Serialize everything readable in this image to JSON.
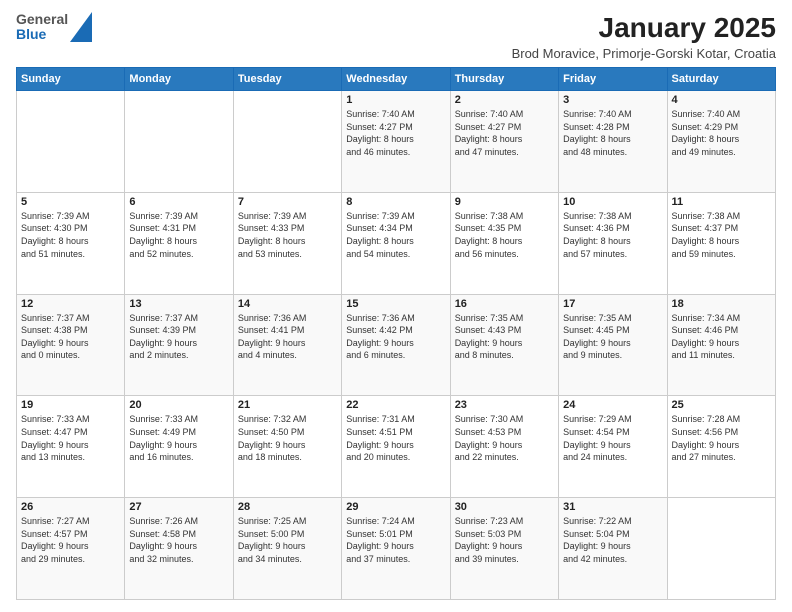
{
  "logo": {
    "general": "General",
    "blue": "Blue"
  },
  "title": "January 2025",
  "subtitle": "Brod Moravice, Primorje-Gorski Kotar, Croatia",
  "weekdays": [
    "Sunday",
    "Monday",
    "Tuesday",
    "Wednesday",
    "Thursday",
    "Friday",
    "Saturday"
  ],
  "weeks": [
    [
      {
        "day": "",
        "info": ""
      },
      {
        "day": "",
        "info": ""
      },
      {
        "day": "",
        "info": ""
      },
      {
        "day": "1",
        "info": "Sunrise: 7:40 AM\nSunset: 4:27 PM\nDaylight: 8 hours\nand 46 minutes."
      },
      {
        "day": "2",
        "info": "Sunrise: 7:40 AM\nSunset: 4:27 PM\nDaylight: 8 hours\nand 47 minutes."
      },
      {
        "day": "3",
        "info": "Sunrise: 7:40 AM\nSunset: 4:28 PM\nDaylight: 8 hours\nand 48 minutes."
      },
      {
        "day": "4",
        "info": "Sunrise: 7:40 AM\nSunset: 4:29 PM\nDaylight: 8 hours\nand 49 minutes."
      }
    ],
    [
      {
        "day": "5",
        "info": "Sunrise: 7:39 AM\nSunset: 4:30 PM\nDaylight: 8 hours\nand 51 minutes."
      },
      {
        "day": "6",
        "info": "Sunrise: 7:39 AM\nSunset: 4:31 PM\nDaylight: 8 hours\nand 52 minutes."
      },
      {
        "day": "7",
        "info": "Sunrise: 7:39 AM\nSunset: 4:33 PM\nDaylight: 8 hours\nand 53 minutes."
      },
      {
        "day": "8",
        "info": "Sunrise: 7:39 AM\nSunset: 4:34 PM\nDaylight: 8 hours\nand 54 minutes."
      },
      {
        "day": "9",
        "info": "Sunrise: 7:38 AM\nSunset: 4:35 PM\nDaylight: 8 hours\nand 56 minutes."
      },
      {
        "day": "10",
        "info": "Sunrise: 7:38 AM\nSunset: 4:36 PM\nDaylight: 8 hours\nand 57 minutes."
      },
      {
        "day": "11",
        "info": "Sunrise: 7:38 AM\nSunset: 4:37 PM\nDaylight: 8 hours\nand 59 minutes."
      }
    ],
    [
      {
        "day": "12",
        "info": "Sunrise: 7:37 AM\nSunset: 4:38 PM\nDaylight: 9 hours\nand 0 minutes."
      },
      {
        "day": "13",
        "info": "Sunrise: 7:37 AM\nSunset: 4:39 PM\nDaylight: 9 hours\nand 2 minutes."
      },
      {
        "day": "14",
        "info": "Sunrise: 7:36 AM\nSunset: 4:41 PM\nDaylight: 9 hours\nand 4 minutes."
      },
      {
        "day": "15",
        "info": "Sunrise: 7:36 AM\nSunset: 4:42 PM\nDaylight: 9 hours\nand 6 minutes."
      },
      {
        "day": "16",
        "info": "Sunrise: 7:35 AM\nSunset: 4:43 PM\nDaylight: 9 hours\nand 8 minutes."
      },
      {
        "day": "17",
        "info": "Sunrise: 7:35 AM\nSunset: 4:45 PM\nDaylight: 9 hours\nand 9 minutes."
      },
      {
        "day": "18",
        "info": "Sunrise: 7:34 AM\nSunset: 4:46 PM\nDaylight: 9 hours\nand 11 minutes."
      }
    ],
    [
      {
        "day": "19",
        "info": "Sunrise: 7:33 AM\nSunset: 4:47 PM\nDaylight: 9 hours\nand 13 minutes."
      },
      {
        "day": "20",
        "info": "Sunrise: 7:33 AM\nSunset: 4:49 PM\nDaylight: 9 hours\nand 16 minutes."
      },
      {
        "day": "21",
        "info": "Sunrise: 7:32 AM\nSunset: 4:50 PM\nDaylight: 9 hours\nand 18 minutes."
      },
      {
        "day": "22",
        "info": "Sunrise: 7:31 AM\nSunset: 4:51 PM\nDaylight: 9 hours\nand 20 minutes."
      },
      {
        "day": "23",
        "info": "Sunrise: 7:30 AM\nSunset: 4:53 PM\nDaylight: 9 hours\nand 22 minutes."
      },
      {
        "day": "24",
        "info": "Sunrise: 7:29 AM\nSunset: 4:54 PM\nDaylight: 9 hours\nand 24 minutes."
      },
      {
        "day": "25",
        "info": "Sunrise: 7:28 AM\nSunset: 4:56 PM\nDaylight: 9 hours\nand 27 minutes."
      }
    ],
    [
      {
        "day": "26",
        "info": "Sunrise: 7:27 AM\nSunset: 4:57 PM\nDaylight: 9 hours\nand 29 minutes."
      },
      {
        "day": "27",
        "info": "Sunrise: 7:26 AM\nSunset: 4:58 PM\nDaylight: 9 hours\nand 32 minutes."
      },
      {
        "day": "28",
        "info": "Sunrise: 7:25 AM\nSunset: 5:00 PM\nDaylight: 9 hours\nand 34 minutes."
      },
      {
        "day": "29",
        "info": "Sunrise: 7:24 AM\nSunset: 5:01 PM\nDaylight: 9 hours\nand 37 minutes."
      },
      {
        "day": "30",
        "info": "Sunrise: 7:23 AM\nSunset: 5:03 PM\nDaylight: 9 hours\nand 39 minutes."
      },
      {
        "day": "31",
        "info": "Sunrise: 7:22 AM\nSunset: 5:04 PM\nDaylight: 9 hours\nand 42 minutes."
      },
      {
        "day": "",
        "info": ""
      }
    ]
  ]
}
